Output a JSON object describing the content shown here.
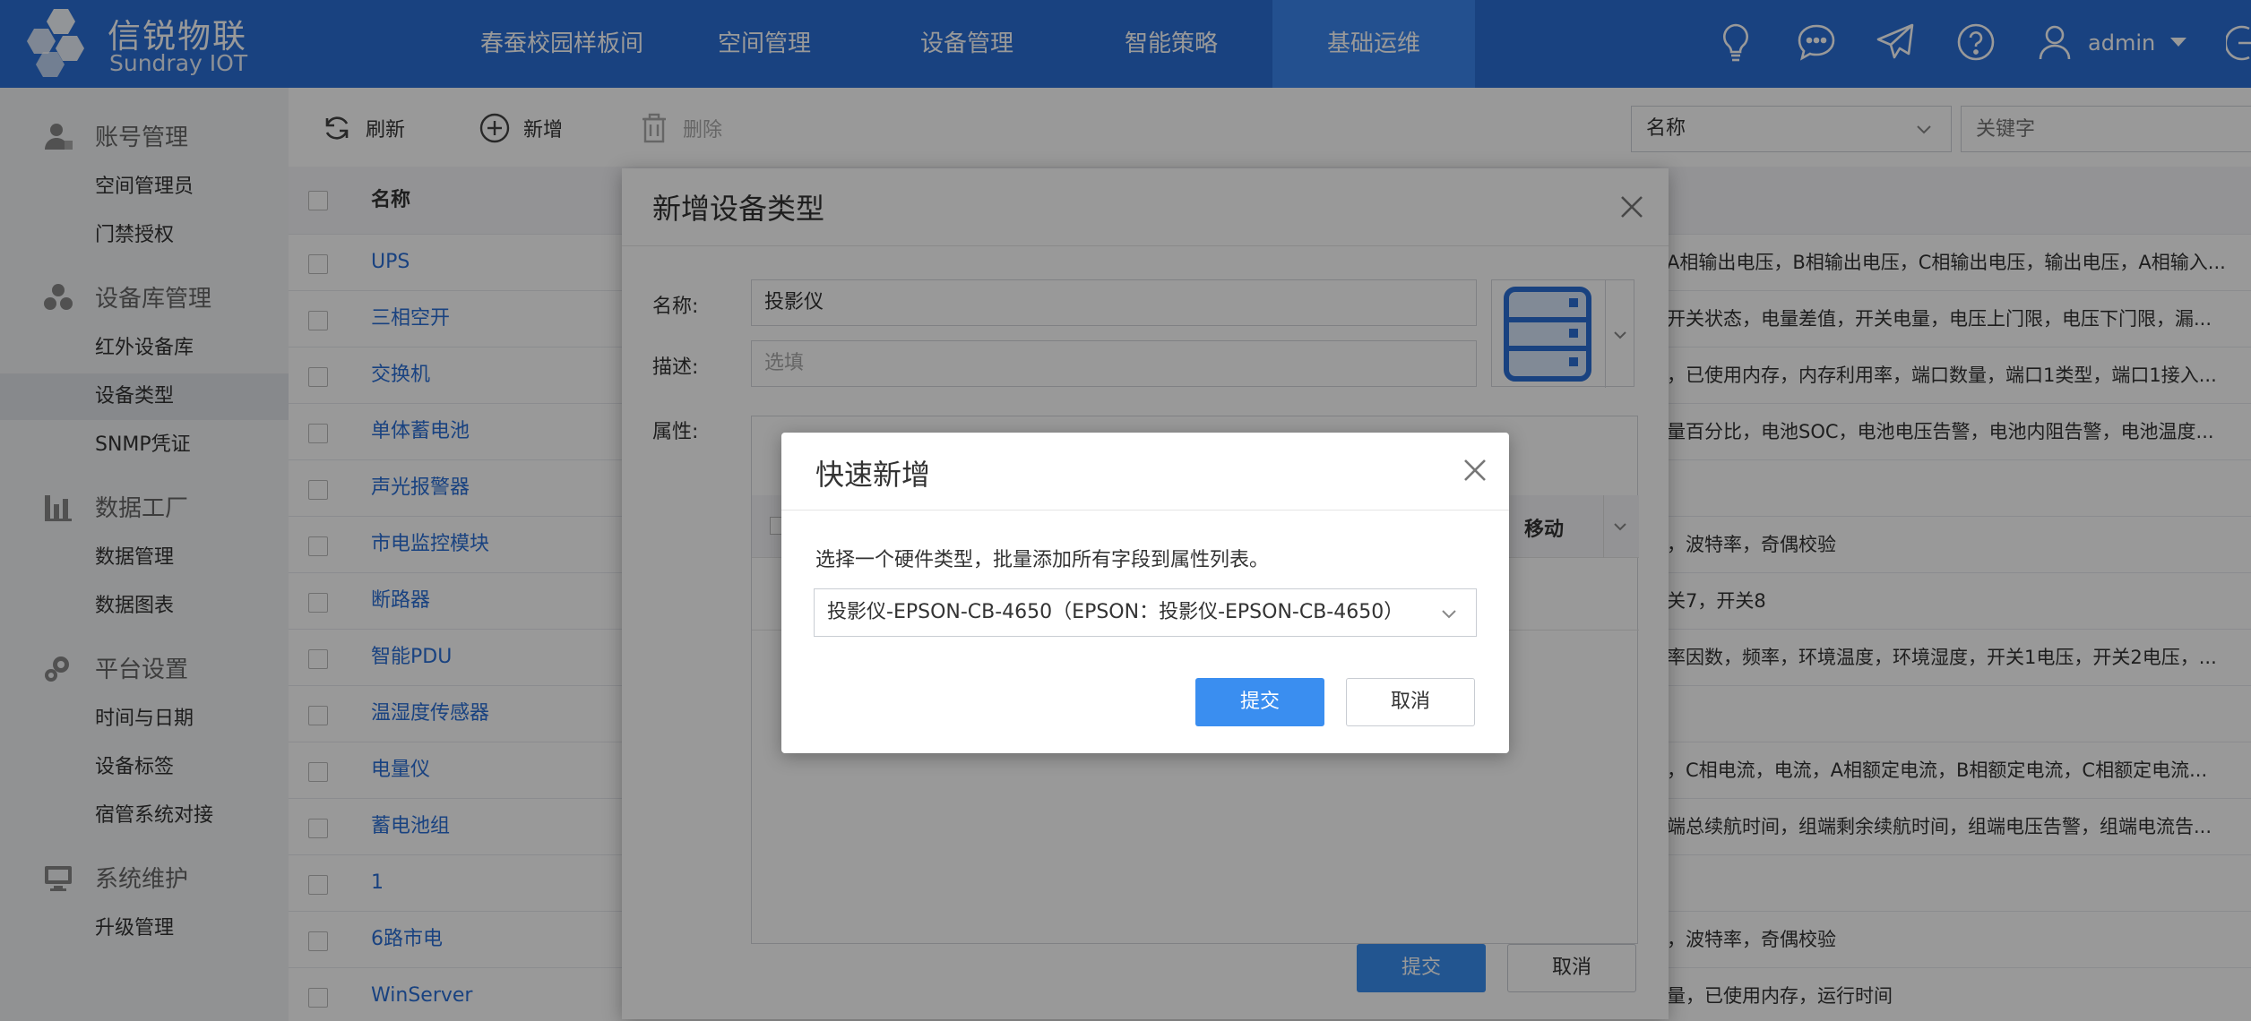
{
  "brand": {
    "name_cn": "信锐物联",
    "name_en": "Sundray IOT"
  },
  "topnav": {
    "items": [
      {
        "label": "春蚕校园样板间"
      },
      {
        "label": "空间管理"
      },
      {
        "label": "设备管理"
      },
      {
        "label": "智能策略"
      },
      {
        "label": "基础运维",
        "active": true
      }
    ],
    "icons": [
      "bulb-icon",
      "chat-icon",
      "send-icon",
      "help-icon",
      "user-icon"
    ],
    "user": "admin"
  },
  "sidebar": {
    "groups": [
      {
        "label": "账号管理",
        "icon": "account-icon",
        "items": [
          "空间管理员",
          "门禁授权"
        ]
      },
      {
        "label": "设备库管理",
        "icon": "device-library-icon",
        "items": [
          "红外设备库",
          "设备类型",
          "SNMP凭证"
        ]
      },
      {
        "label": "数据工厂",
        "icon": "data-factory-icon",
        "items": [
          "数据管理",
          "数据图表"
        ]
      },
      {
        "label": "平台设置",
        "icon": "settings-icon",
        "items": [
          "时间与日期",
          "设备标签",
          "宿管系统对接"
        ]
      },
      {
        "label": "系统维护",
        "icon": "maintenance-icon",
        "items": [
          "升级管理"
        ]
      }
    ],
    "active_item": "设备类型"
  },
  "toolbar": {
    "refresh": "刷新",
    "add": "新增",
    "delete": "删除"
  },
  "filter": {
    "field": "名称",
    "keyword_placeholder": "关键字"
  },
  "table": {
    "header": {
      "name": "名称"
    },
    "rows": [
      {
        "name": "UPS",
        "attrs": "A相输出电压，B相输出电压，C相输出电压，输出电压，A相输入..."
      },
      {
        "name": "三相空开",
        "attrs": "开关状态，电量差值，开关电量，电压上门限，电压下门限，漏..."
      },
      {
        "name": "交换机",
        "attrs": "，已使用内存，内存利用率，端口数量，端口1类型，端口1接入..."
      },
      {
        "name": "单体蓄电池",
        "attrs": "量百分比，电池SOC，电池电压告警，电池内阻告警，电池温度..."
      },
      {
        "name": "声光报警器",
        "attrs": ""
      },
      {
        "name": "市电监控模块",
        "attrs": "，波特率，奇偶校验"
      },
      {
        "name": "断路器",
        "attrs": "关7，开关8"
      },
      {
        "name": "智能PDU",
        "attrs": "率因数，频率，环境温度，环境湿度，开关1电压，开关2电压，..."
      },
      {
        "name": "温湿度传感器",
        "attrs": ""
      },
      {
        "name": "电量仪",
        "attrs": "，C相电流，电流，A相额定电流，B相额定电流，C相额定电流..."
      },
      {
        "name": "蓄电池组",
        "attrs": "端总续航时间，组端剩余续航时间，组端电压告警，组端电流告..."
      },
      {
        "name": "1",
        "attrs": ""
      },
      {
        "name": "6路市电",
        "attrs": "，波特率，奇偶校验"
      },
      {
        "name": "WinServer",
        "attrs": "量，已使用内存，运行时间"
      }
    ]
  },
  "dialog_add_type": {
    "title": "新增设备类型",
    "name_label": "名称:",
    "name_value": "投影仪",
    "desc_label": "描述:",
    "desc_placeholder": "选填",
    "attr_label": "属性:",
    "attr_col_move": "移动",
    "submit": "提交",
    "cancel": "取消"
  },
  "dialog_quick_add": {
    "title": "快速新增",
    "description": "选择一个硬件类型，批量添加所有字段到属性列表。",
    "selected": "投影仪-EPSON-CB-4650（EPSON：投影仪-EPSON-CB-4650）",
    "submit": "提交",
    "cancel": "取消"
  },
  "colors": {
    "header_blue": "#2b6fd6",
    "active_tab": "#3b86ee",
    "primary_button": "#3a8ef0",
    "link": "#2b6fd6"
  }
}
